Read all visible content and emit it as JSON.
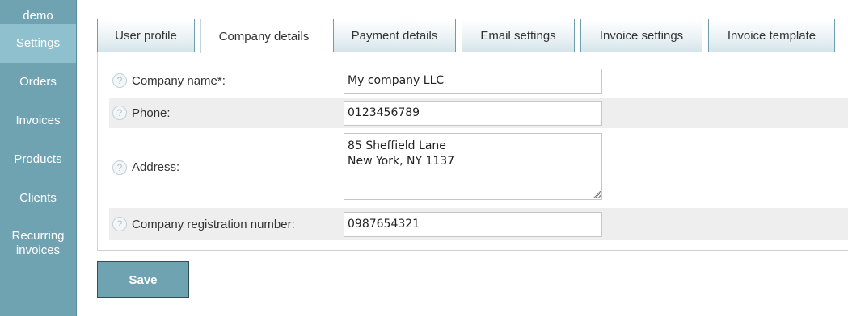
{
  "sidebar": {
    "user": "demo",
    "items": [
      {
        "label": "Settings",
        "active": true
      },
      {
        "label": "Orders"
      },
      {
        "label": "Invoices"
      },
      {
        "label": "Products"
      },
      {
        "label": "Clients"
      },
      {
        "label": "Recurring invoices"
      }
    ]
  },
  "tabs": [
    {
      "label": "User profile"
    },
    {
      "label": "Company details",
      "active": true
    },
    {
      "label": "Payment details"
    },
    {
      "label": "Email settings"
    },
    {
      "label": "Invoice settings"
    },
    {
      "label": "Invoice template"
    }
  ],
  "form": {
    "fields": [
      {
        "label": "Company name*:",
        "value": "My company LLC"
      },
      {
        "label": "Phone:",
        "value": "0123456789"
      },
      {
        "label": "Address:",
        "value": "85 Sheffield Lane\nNew York, NY 1137"
      },
      {
        "label": "Company registration number:",
        "value": "0987654321"
      }
    ],
    "help_glyph": "?",
    "save_label": "Save"
  },
  "colors": {
    "sidebar_bg": "#6fa3b2",
    "sidebar_active": "#8fc0ce",
    "save_button_bg": "#6fa3b2",
    "row_shade": "#eeeeee"
  },
  "icons": {
    "help": "help-icon",
    "resize": "resize-grip-icon"
  }
}
